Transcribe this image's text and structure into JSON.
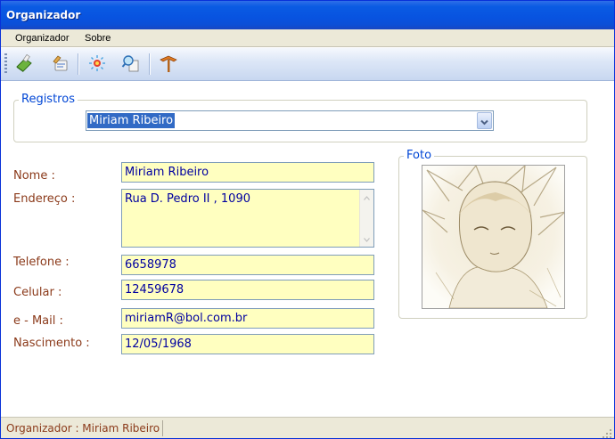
{
  "window": {
    "title": "Organizador"
  },
  "menu": {
    "items": [
      "Organizador",
      "Sobre"
    ]
  },
  "toolbar": {
    "buttons": [
      {
        "icon": "book-add-icon"
      },
      {
        "icon": "edit-record-icon"
      },
      {
        "icon": "delete-record-icon"
      },
      {
        "icon": "search-icon"
      },
      {
        "icon": "exit-icon"
      }
    ]
  },
  "registros": {
    "legend": "Registros",
    "selected": "Miriam Ribeiro"
  },
  "form": {
    "nome": {
      "label": "Nome :",
      "value": "Miriam Ribeiro"
    },
    "endereco": {
      "label": "Endereço :",
      "value": "Rua D. Pedro II , 1090"
    },
    "telefone": {
      "label": "Telefone :",
      "value": "6658978"
    },
    "celular": {
      "label": "Celular :",
      "value": "12459678"
    },
    "email": {
      "label": "e - Mail :",
      "value": "miriamR@bol.com.br"
    },
    "nascimento": {
      "label": "Nascimento :",
      "value": "12/05/1968"
    }
  },
  "foto": {
    "legend": "Foto"
  },
  "status": {
    "text": "Organizador : Miriam Ribeiro"
  },
  "colors": {
    "accent": "#0046d5",
    "label": "#8b3a1a",
    "field_bg": "#ffffc0",
    "field_text": "#0000a0",
    "selection": "#316ac5"
  }
}
